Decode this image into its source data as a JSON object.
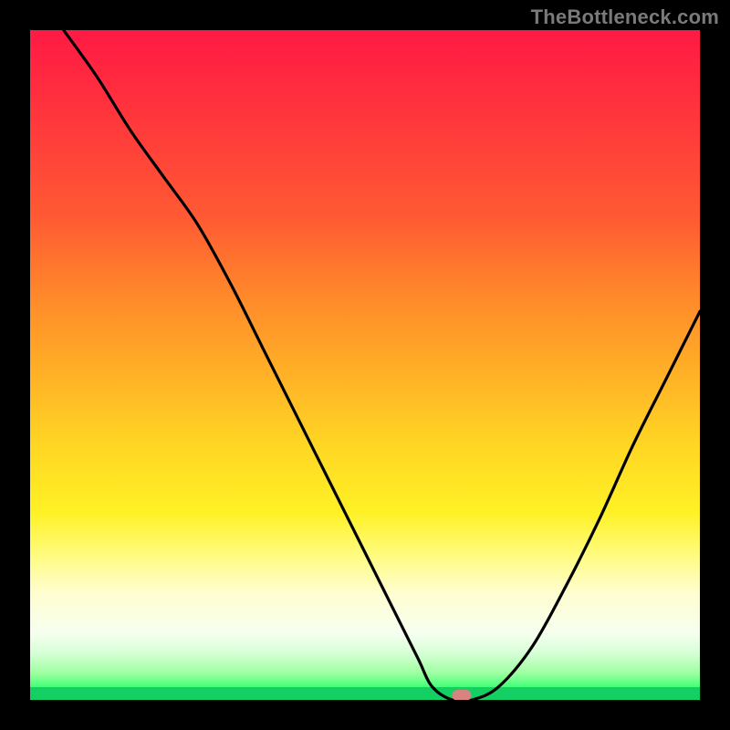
{
  "watermark": "TheBottleneck.com",
  "chart_data": {
    "type": "line",
    "title": "",
    "xlabel": "",
    "ylabel": "",
    "xlim": [
      0,
      100
    ],
    "ylim": [
      0,
      100
    ],
    "series": [
      {
        "name": "curve",
        "x": [
          5,
          10,
          15,
          20,
          25,
          30,
          35,
          40,
          45,
          50,
          55,
          58,
          60,
          63,
          66,
          70,
          75,
          80,
          85,
          90,
          95,
          100
        ],
        "values": [
          100,
          93,
          85,
          78,
          71,
          62,
          52,
          42,
          32,
          22,
          12,
          6,
          2,
          0,
          0,
          2,
          8,
          17,
          27,
          38,
          48,
          58
        ]
      }
    ],
    "marker": {
      "x": 64.5,
      "y": 0.7,
      "shape": "pill",
      "color": "#d98380"
    },
    "background_gradient": {
      "stops": [
        {
          "pos": 0,
          "color": "#ff1a44"
        },
        {
          "pos": 0.28,
          "color": "#ff5a33"
        },
        {
          "pos": 0.52,
          "color": "#ffb326"
        },
        {
          "pos": 0.72,
          "color": "#fff125"
        },
        {
          "pos": 0.9,
          "color": "#f6ffef"
        },
        {
          "pos": 1.0,
          "color": "#13e56a"
        }
      ]
    }
  }
}
